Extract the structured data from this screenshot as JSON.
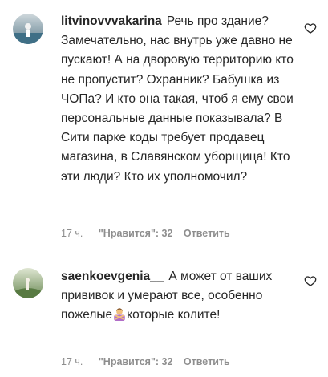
{
  "comments": [
    {
      "username": "litvinovvvakarina",
      "text": "Речь про здание? Замечательно, нас внутрь уже давно не пускают! А на дворовую территорию кто не пропустит? Охранник? Бабушка из ЧОПа? И кто она такая, чтоб я ему свои персональные данные показывала? В Сити парке коды требует продавец магазина, в Славянском уборщица! Кто эти люди? Кто их уполномочил?",
      "time": "17 ч.",
      "likes": "\"Нравится\": 32",
      "reply": "Ответить",
      "avatar_icon": "user-avatar-icon",
      "like_icon": "heart-outline-icon"
    },
    {
      "username": "saenkoevgenia__",
      "text_before_emoji": "А может от ваших прививок и умерают все, особенно пожелые",
      "emoji": "person-gesturing-no-emoji",
      "text_after_emoji": "которые колите!",
      "time": "17 ч.",
      "likes": "\"Нравится\": 32",
      "reply": "Ответить",
      "avatar_icon": "user-avatar-icon",
      "like_icon": "heart-outline-icon"
    }
  ],
  "colors": {
    "text": "#262626",
    "meta": "#8e8e8e",
    "background": "#ffffff"
  }
}
